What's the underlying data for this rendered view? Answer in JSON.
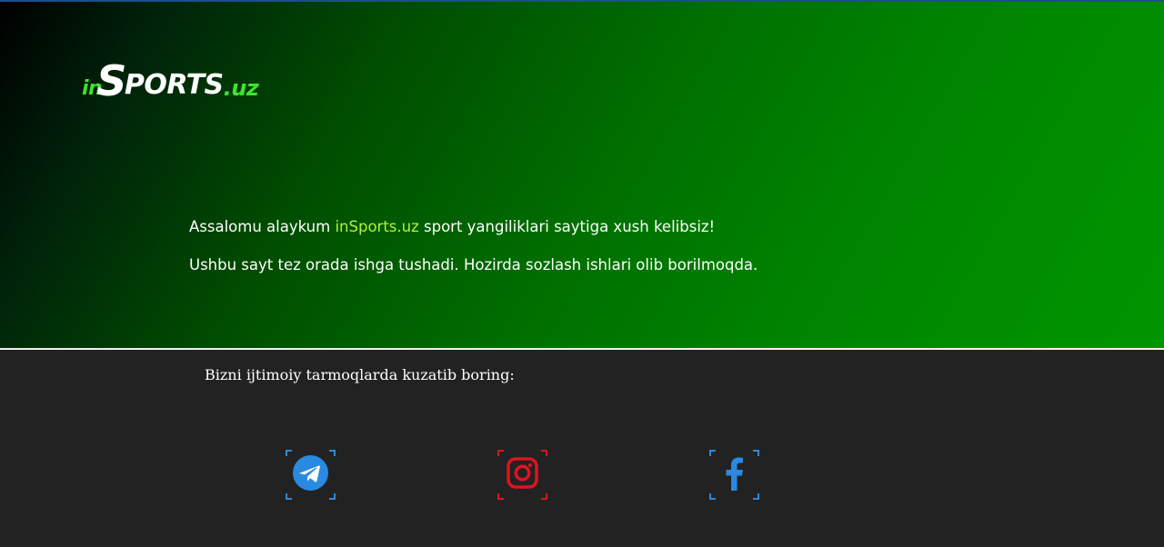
{
  "logo": {
    "in": "in",
    "s": "S",
    "ports": "PORTS",
    "tld": ".uz"
  },
  "hero": {
    "welcome_before": "Assalomu alaykum ",
    "welcome_brand": "inSports.uz",
    "welcome_after": " sport yangiliklari saytiga xush kelibsiz!",
    "notice": "Ushbu sayt tez orada ishga tushadi. Hozirda sozlash ishlari olib borilmoqda."
  },
  "footer": {
    "follow_text": "Bizni ijtimoiy tarmoqlarda kuzatib boring:",
    "social": [
      {
        "icon": "telegram-icon",
        "color": "#2a89e0"
      },
      {
        "icon": "instagram-icon",
        "color": "#e0131f"
      },
      {
        "icon": "facebook-icon",
        "color": "#2a89e0"
      }
    ]
  },
  "colors": {
    "accent_green": "#3fe22f",
    "brand_text": "#b3f23b",
    "footer_bg": "#222222"
  }
}
